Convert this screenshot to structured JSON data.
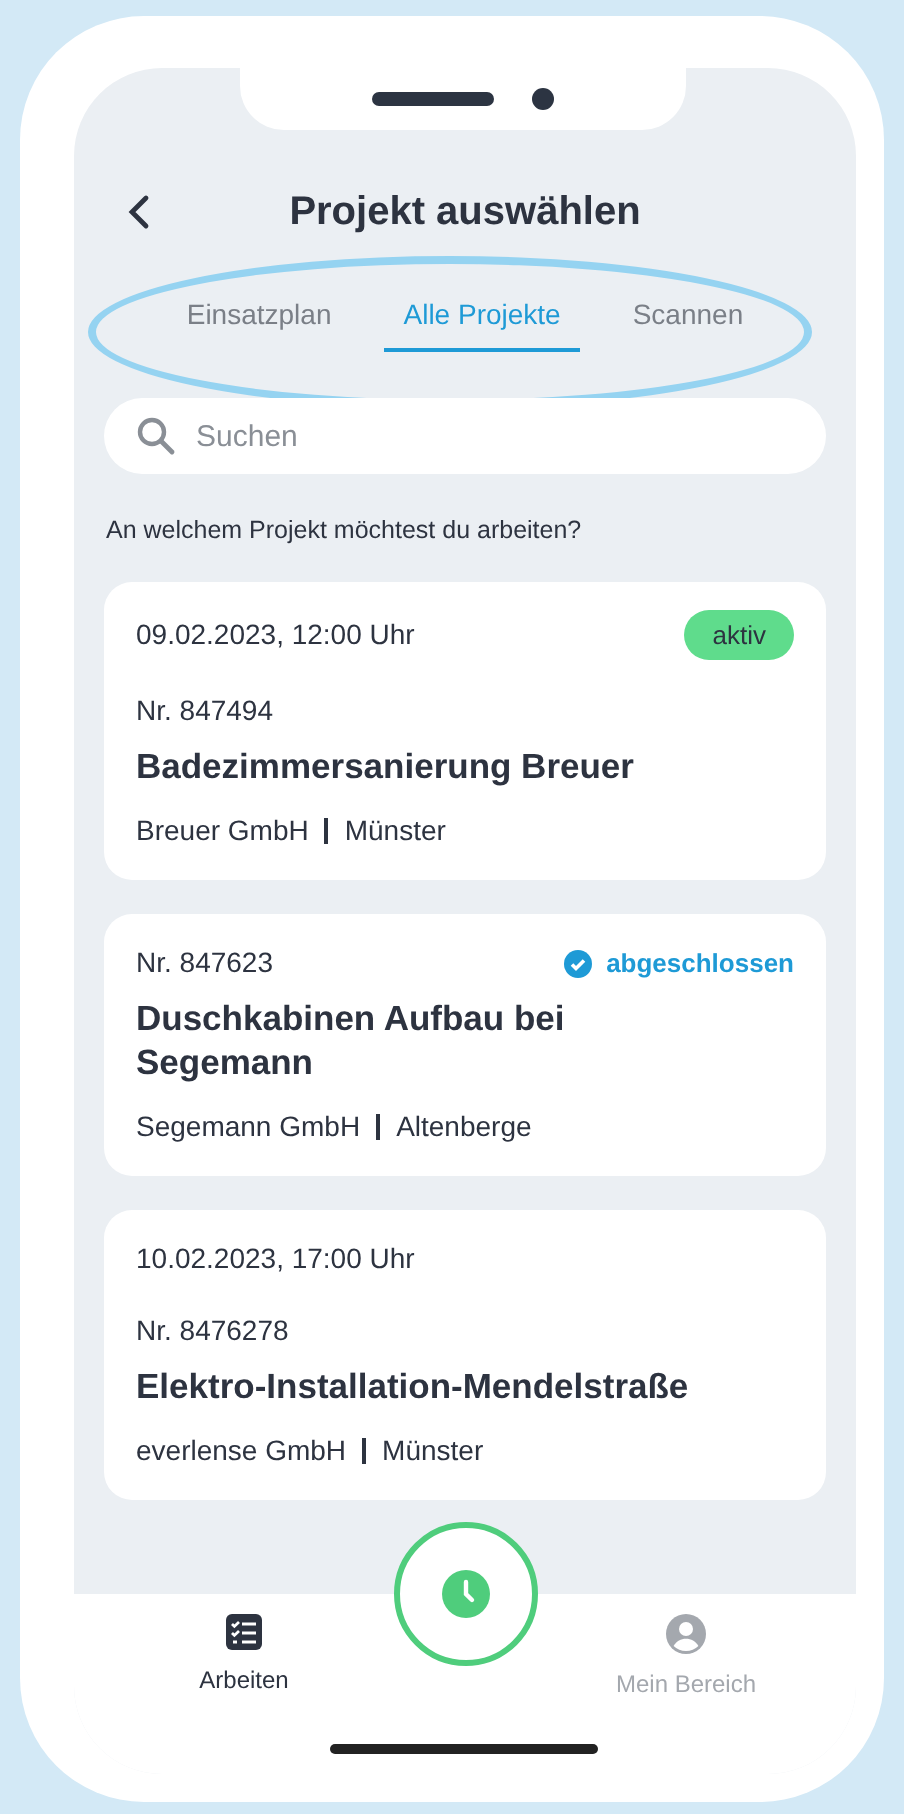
{
  "header": {
    "title": "Projekt auswählen"
  },
  "tabs": [
    {
      "label": "Einsatzplan",
      "selected": false
    },
    {
      "label": "Alle Projekte",
      "selected": true
    },
    {
      "label": "Scannen",
      "selected": false
    }
  ],
  "search": {
    "placeholder": "Suchen"
  },
  "prompt": "An welchem Projekt möchtest du arbeiten?",
  "projects": [
    {
      "date": "09.02.2023, 12:00 Uhr",
      "status": {
        "kind": "active",
        "label": "aktiv"
      },
      "number": "Nr. 847494",
      "title": "Badezimmersanierung Breuer",
      "company": "Breuer GmbH",
      "city": "Münster"
    },
    {
      "status": {
        "kind": "completed",
        "label": "abgeschlossen"
      },
      "number": "Nr. 847623",
      "title": "Duschkabinen Aufbau bei Segemann",
      "company": "Segemann GmbH",
      "city": "Altenberge"
    },
    {
      "date": "10.02.2023, 17:00 Uhr",
      "number": "Nr. 8476278",
      "title": "Elektro-Installation-Mendelstraße",
      "company": "everlense GmbH",
      "city": "Münster"
    }
  ],
  "bottom_nav": [
    {
      "kind": "list",
      "label": "Arbeiten",
      "selected": true
    },
    {
      "kind": "timer"
    },
    {
      "kind": "profile",
      "label": "Mein Bereich",
      "selected": false
    }
  ]
}
